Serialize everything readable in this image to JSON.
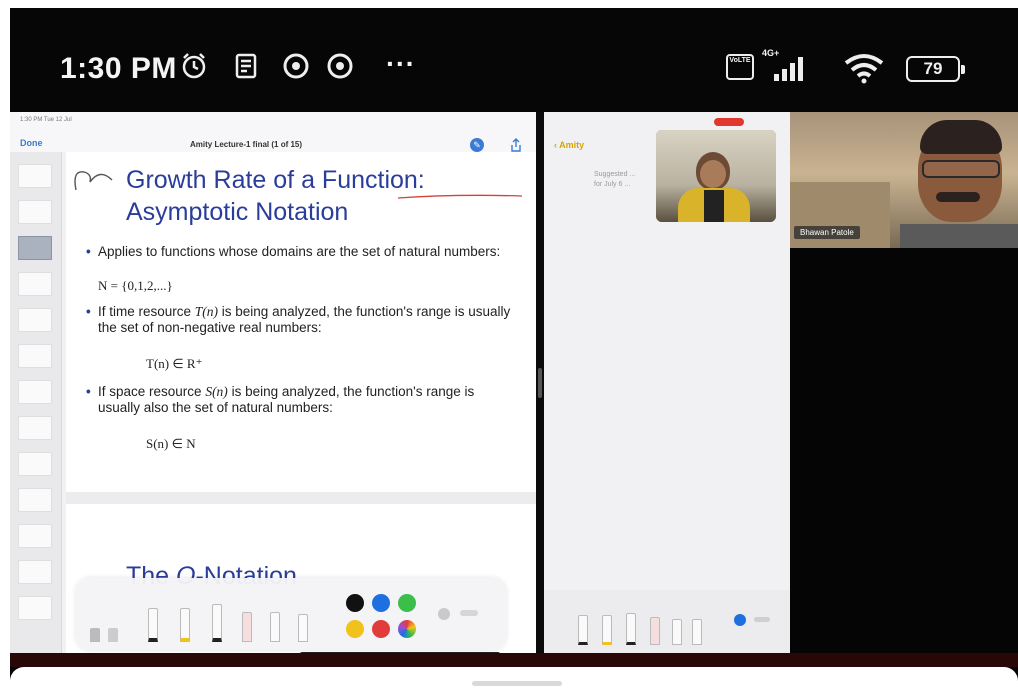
{
  "status_bar": {
    "time": "1:30 PM",
    "left_icons": [
      "alarm-icon",
      "notes-icon",
      "chrome-icon",
      "chrome-icon"
    ],
    "more": "···",
    "network_type": "VoLTE",
    "network_label": "4G+",
    "battery_level": "79"
  },
  "doc_app": {
    "done_label": "Done",
    "status_time": "1:30 PM  Tue 12 Jul",
    "document_title": "Amity Lecture-1 final (1 of 15)",
    "slide1": {
      "heading_line1": "Growth Rate of a Function:",
      "heading_line2": "Asymptotic Notation",
      "bullet1_text": "Applies to functions whose domains are the set of natural numbers:",
      "bullet1_math": "N = {0,1,2,...}",
      "bullet2_text_a": "If time resource ",
      "bullet2_var": "T(n)",
      "bullet2_text_b": " is being analyzed, the function's range is usually the set of non-negative real numbers:",
      "bullet2_math": "T(n) ∈ R⁺",
      "bullet3_text_a": "If space resource ",
      "bullet3_var": "S(n)",
      "bullet3_text_b": " is being analyzed, the function's range is usually also the set of natural numbers:",
      "bullet3_math": "S(n) ∈ N"
    },
    "slide2": {
      "heading_prefix": "The ",
      "heading_italic": "O",
      "heading_suffix": "-Notation"
    },
    "toolbar": {
      "colors": [
        "#111111",
        "#1e6fe0",
        "#3bbf4a",
        "#f2c21c",
        "#e23b3b",
        "multicolor"
      ]
    }
  },
  "notes_app": {
    "back_label": "Amity",
    "suggested_text": "Suggested ...\nfor July 6 ..."
  },
  "video": {
    "participant_name": "Bhawan Patole"
  }
}
